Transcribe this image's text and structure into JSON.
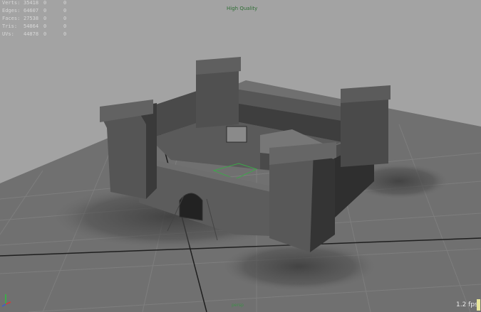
{
  "hud": {
    "rows": [
      {
        "label": "Verts:",
        "value": "35418",
        "a": "0",
        "b": "0"
      },
      {
        "label": "Edges:",
        "value": "64607",
        "a": "0",
        "b": "0"
      },
      {
        "label": "Faces:",
        "value": "27538",
        "a": "0",
        "b": "0"
      },
      {
        "label": "Tris:",
        "value": "54864",
        "a": "0",
        "b": "0"
      },
      {
        "label": "UVs:",
        "value": "44878",
        "a": "0",
        "b": "0"
      }
    ]
  },
  "viewport": {
    "quality_label": "High Quality",
    "fps": "1.2 fps",
    "camera": "persp",
    "background_color": "#a3a3a3",
    "grid_color": "#5e5e5e",
    "ground_color": "#6f6f6f"
  },
  "axis_icon": {
    "x": "x",
    "y": "y",
    "z": "z"
  }
}
